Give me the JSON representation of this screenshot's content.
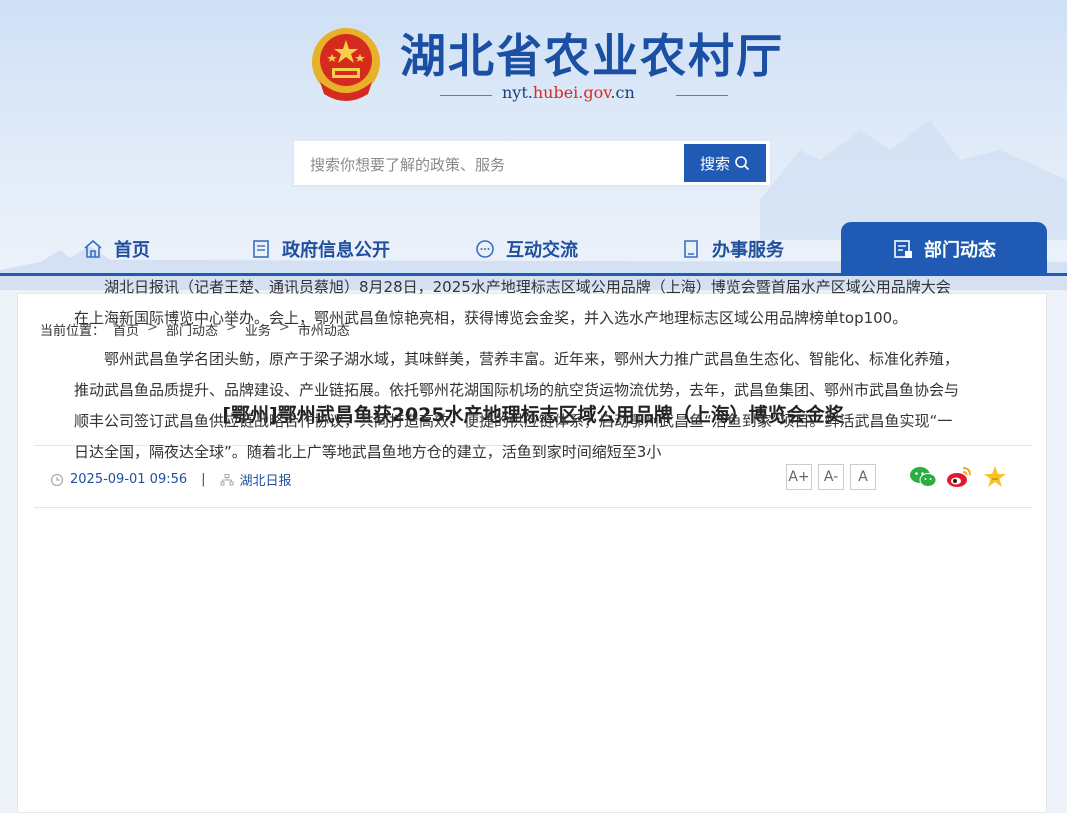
{
  "header": {
    "site_title": "湖北省农业农村厅",
    "url_prefix": "nyt.",
    "url_highlight": "hubei.gov",
    "url_suffix": ".cn"
  },
  "search": {
    "placeholder": "搜索你想要了解的政策、服务",
    "button_label": "搜索"
  },
  "nav": {
    "items": [
      {
        "label": "首页",
        "icon": "home-icon"
      },
      {
        "label": "政府信息公开",
        "icon": "document-icon"
      },
      {
        "label": "互动交流",
        "icon": "chat-icon"
      },
      {
        "label": "办事服务",
        "icon": "bookmark-icon"
      },
      {
        "label": "部门动态",
        "icon": "news-icon",
        "active": true
      }
    ]
  },
  "breadcrumb": {
    "prefix": "当前位置：",
    "items": [
      "首页",
      "部门动态",
      "业务",
      "市州动态"
    ],
    "separator": ">"
  },
  "article": {
    "title": "[鄂州]鄂州武昌鱼获2025水产地理标志区域公用品牌（上海）博览会金奖",
    "datetime": "2025-09-01 09:56",
    "divider": "|",
    "source": "湖北日报",
    "font_sizes": [
      "A+",
      "A-",
      "A"
    ],
    "paragraphs": [
      "湖北日报讯（记者王楚、通讯员蔡旭）8月28日，2025水产地理标志区域公用品牌（上海）博览会暨首届水产区域公用品牌大会在上海新国际博览中心举办。会上，鄂州武昌鱼惊艳亮相，获得博览会金奖，并入选水产地理标志区域公用品牌榜单top100。",
      "鄂州武昌鱼学名团头鲂，原产于梁子湖水域，其味鲜美，营养丰富。近年来，鄂州大力推广武昌鱼生态化、智能化、标准化养殖，推动武昌鱼品质提升、品牌建设、产业链拓展。依托鄂州花湖国际机场的航空货运物流优势，去年，武昌鱼集团、鄂州市武昌鱼协会与顺丰公司签订武昌鱼供应链战略合作协议，共同打造高效、便捷的供应链体系，启动鄂州武昌鱼“活鱼到家”项目。鲜活武昌鱼实现“一日达全国，隔夜达全球”。随着北上广等地武昌鱼地方仓的建立，活鱼到家时间缩短至3小"
    ]
  },
  "colors": {
    "brand_blue": "#1f5bb5",
    "title_blue": "#1a4fa3",
    "url_red": "#d42a22"
  }
}
